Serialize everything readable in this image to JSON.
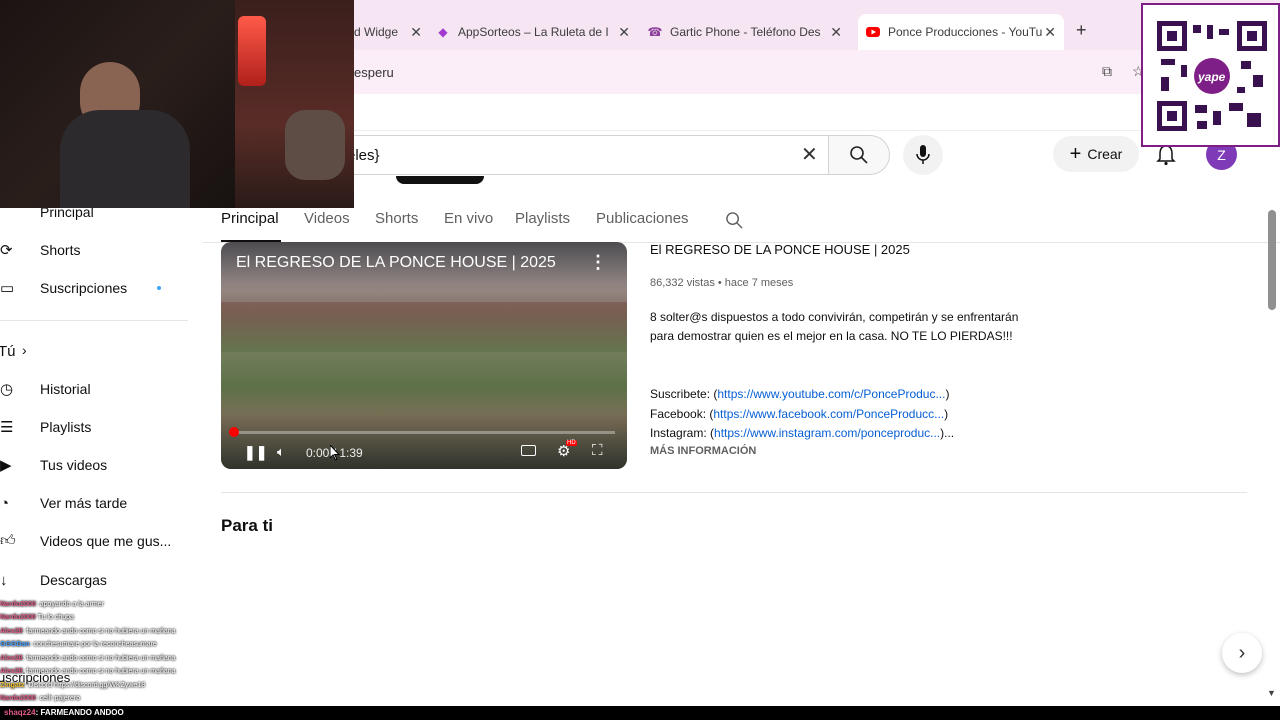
{
  "tabs": [
    {
      "label": "d Widge",
      "icon": "widget-icon",
      "active": false
    },
    {
      "label": "AppSorteos – La Ruleta de I",
      "icon": "appsorteos-icon",
      "active": false
    },
    {
      "label": "Gartic Phone - Teléfono Des",
      "icon": "gartic-phone-icon",
      "active": false
    },
    {
      "label": "Ponce Producciones - YouTu",
      "icon": "youtube-icon",
      "active": true
    }
  ],
  "address": {
    "text": "esperu"
  },
  "search": {
    "value": "eles}"
  },
  "masthead": {
    "create_label": "Crear",
    "avatar_letter": "Z"
  },
  "sidebar": {
    "items": [
      {
        "label": "Principal",
        "icon": "home-icon"
      },
      {
        "label": "Shorts",
        "icon": "shorts-icon"
      },
      {
        "label": "Suscripciones",
        "icon": "subscriptions-icon"
      },
      {
        "label": "Tú",
        "icon": "chevron-right-icon"
      },
      {
        "label": "Historial",
        "icon": "history-icon"
      },
      {
        "label": "Playlists",
        "icon": "playlists-icon"
      },
      {
        "label": "Tus videos",
        "icon": "your-videos-icon"
      },
      {
        "label": "Ver más tarde",
        "icon": "watch-later-icon"
      },
      {
        "label": "Videos que me gus...",
        "icon": "like-icon"
      },
      {
        "label": "Descargas",
        "icon": "download-icon"
      }
    ],
    "subs_heading": "uscripciones"
  },
  "channel_tabs": [
    "Principal",
    "Videos",
    "Shorts",
    "En vivo",
    "Playlists",
    "Publicaciones"
  ],
  "featured": {
    "player_title": "El REGRESO DE LA PONCE HOUSE | 2025",
    "time": "0:00 / 1:39",
    "progress": 0.0,
    "title": "El REGRESO DE LA PONCE HOUSE | 2025",
    "meta": "86,332 vistas • hace 7 meses",
    "description": "8 solter@s dispuestos a todo convivirán, competirán y se enfrentarán para demostrar quien es el mejor en la casa. NO TE LO PIERDAS!!!",
    "links": [
      {
        "prefix": "Suscribete: (",
        "url": "https://www.youtube.com/c/PonceProduc...",
        "suffix": ")"
      },
      {
        "prefix": "Facebook: (",
        "url": "https://www.facebook.com/PonceProducc...",
        "suffix": ")"
      },
      {
        "prefix": "Instagram: (",
        "url": "https://www.instagram.com/ponceproduc...",
        "suffix": ")..."
      }
    ],
    "more": "MÁS INFORMACIÓN"
  },
  "section_title": "Para ti",
  "qr": {
    "label": "yape"
  },
  "chat": [
    {
      "name": "Nardo2000",
      "msg": ": apoyando a la armer"
    },
    {
      "name": "Nardo2000",
      "msg": "Tu lo chupa"
    },
    {
      "name": "Alex28",
      "msg": ": farmeando ando como si no hubiera un mañana"
    },
    {
      "name": "GGGDan",
      "msg": ": conchesumare por la reconcheasumare"
    },
    {
      "name": "Alex28",
      "msg": ": farmeando ando como si no hubiera un mañana"
    },
    {
      "name": "Alex28",
      "msg": ": farmeando ando como si no hubiera un mañana"
    },
    {
      "name": "Zingatz",
      "msg": ": Discord https://discord.gg/WKZywe18"
    },
    {
      "name": "Nardo2000",
      "msg": ": cellr pajerero"
    },
    {
      "name": "shaqz24",
      "msg": ": FARMEANDO ANDOO"
    }
  ]
}
